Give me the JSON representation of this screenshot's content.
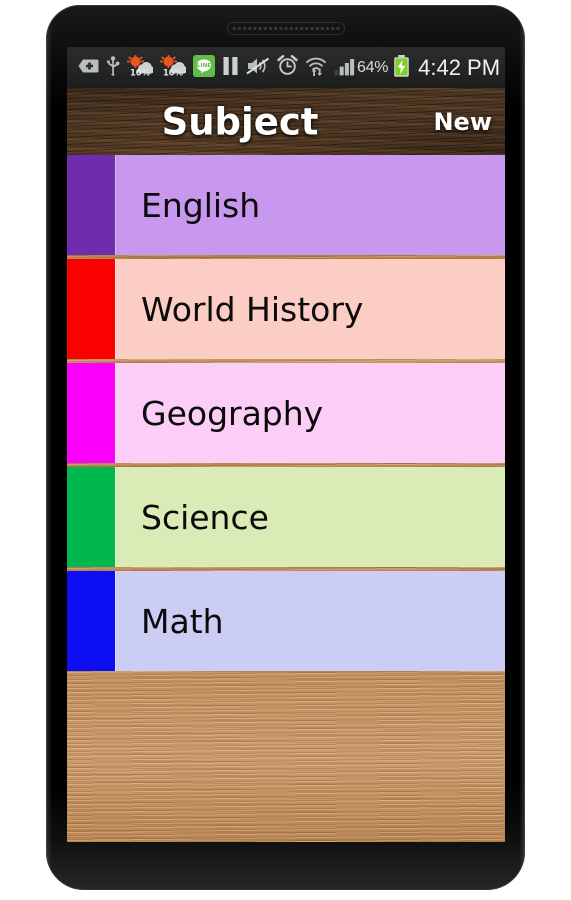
{
  "statusbar": {
    "icons": [
      {
        "name": "add-download-icon",
        "glyph": "+"
      },
      {
        "name": "usb-icon",
        "glyph": "USB"
      },
      {
        "name": "weather-rain-10-percent-icon",
        "glyph": "10%"
      },
      {
        "name": "weather-rain-10-percent-icon-2",
        "glyph": "10%"
      },
      {
        "name": "line-messenger-icon",
        "glyph": "LINE"
      },
      {
        "name": "pause-icon",
        "glyph": "II"
      },
      {
        "name": "mute-icon",
        "glyph": "mute"
      },
      {
        "name": "alarm-clock-icon",
        "glyph": "alarm"
      },
      {
        "name": "wifi-icon",
        "glyph": "wifi"
      },
      {
        "name": "signal-bars-icon",
        "glyph": "signal"
      }
    ],
    "battery_percent": "64%",
    "battery_icon": "battery-charging-icon",
    "clock": "4:42 PM"
  },
  "actionbar": {
    "title": "Subject",
    "new_label": "New"
  },
  "list": {
    "items": [
      {
        "label": "English",
        "swatch_color": "#6F2DAE",
        "row_color": "#C897EE",
        "divider_color": "#b8854f"
      },
      {
        "label": "World History",
        "swatch_color": "#FB0000",
        "row_color": "#FCCDC4",
        "divider_color": "#b8854f"
      },
      {
        "label": "Geography",
        "swatch_color": "#FC00FC",
        "row_color": "#FCCDF6",
        "divider_color": "#b8854f"
      },
      {
        "label": "Science",
        "swatch_color": "#00B84E",
        "row_color": "#DAEBB5",
        "divider_color": "#b8854f"
      },
      {
        "label": "Math",
        "swatch_color": "#0E0EF5",
        "row_color": "#CCCDF5",
        "divider_color": "#b8854f"
      }
    ]
  },
  "theme": {
    "actionbar_wood": "#46301f",
    "list_wood": "#c48f55",
    "status_bar_bg": "#242625",
    "title_text": "#ffffff"
  }
}
